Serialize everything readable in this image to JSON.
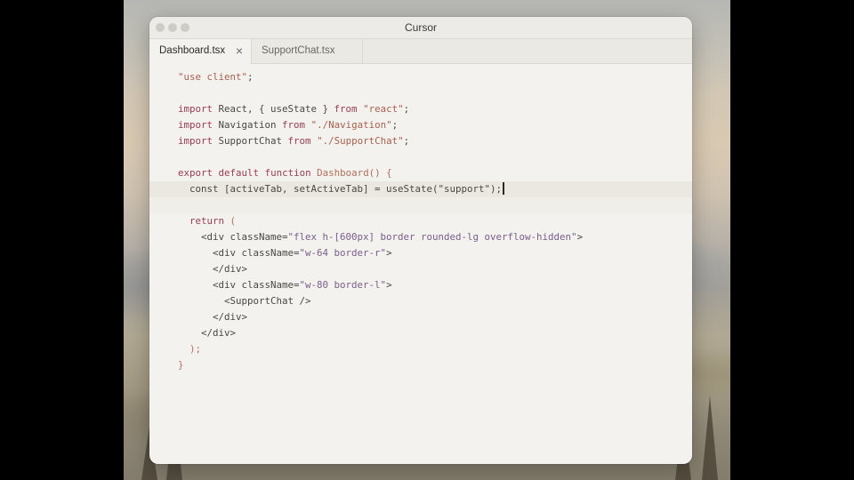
{
  "window": {
    "title": "Cursor"
  },
  "tabs": [
    {
      "label": "Dashboard.tsx",
      "active": true,
      "close_icon": "close-icon"
    },
    {
      "label": "SupportChat.tsx",
      "active": false
    }
  ],
  "editor": {
    "lines": [
      [
        {
          "t": "\"use client\"",
          "c": "str"
        },
        {
          "t": ";",
          "c": "plain"
        }
      ],
      [],
      [
        {
          "t": "import",
          "c": "kw"
        },
        {
          "t": " React, { useState } ",
          "c": "plain"
        },
        {
          "t": "from",
          "c": "kw"
        },
        {
          "t": " ",
          "c": "plain"
        },
        {
          "t": "\"react\"",
          "c": "str"
        },
        {
          "t": ";",
          "c": "plain"
        }
      ],
      [
        {
          "t": "import",
          "c": "kw"
        },
        {
          "t": " Navigation ",
          "c": "plain"
        },
        {
          "t": "from",
          "c": "kw"
        },
        {
          "t": " ",
          "c": "plain"
        },
        {
          "t": "\"./Navigation\"",
          "c": "str"
        },
        {
          "t": ";",
          "c": "plain"
        }
      ],
      [
        {
          "t": "import",
          "c": "kw"
        },
        {
          "t": " SupportChat ",
          "c": "plain"
        },
        {
          "t": "from",
          "c": "kw"
        },
        {
          "t": " ",
          "c": "plain"
        },
        {
          "t": "\"./SupportChat\"",
          "c": "str"
        },
        {
          "t": ";",
          "c": "plain"
        }
      ],
      [],
      [
        {
          "t": "export",
          "c": "kw"
        },
        {
          "t": " ",
          "c": "plain"
        },
        {
          "t": "default",
          "c": "kw"
        },
        {
          "t": " ",
          "c": "plain"
        },
        {
          "t": "function",
          "c": "kw"
        },
        {
          "t": " ",
          "c": "plain"
        },
        {
          "t": "Dashboard",
          "c": "fn"
        },
        {
          "t": "() {",
          "c": "punc"
        }
      ],
      [
        {
          "t": "  const [activeTab, setActiveTab] = useState(\"support\");",
          "c": "plain"
        }
      ],
      [],
      [
        {
          "t": "  ",
          "c": "plain"
        },
        {
          "t": "return",
          "c": "kw"
        },
        {
          "t": " (",
          "c": "punc"
        }
      ],
      [
        {
          "t": "    <div ",
          "c": "tag"
        },
        {
          "t": "className",
          "c": "attr"
        },
        {
          "t": "=",
          "c": "plain"
        },
        {
          "t": "\"flex h-[600px] border rounded-lg overflow-hidden\"",
          "c": "attrval"
        },
        {
          "t": ">",
          "c": "tag"
        }
      ],
      [
        {
          "t": "      <div ",
          "c": "tag"
        },
        {
          "t": "className",
          "c": "attr"
        },
        {
          "t": "=",
          "c": "plain"
        },
        {
          "t": "\"w-64 border-r\"",
          "c": "attrval"
        },
        {
          "t": ">",
          "c": "tag"
        }
      ],
      [
        {
          "t": "      </div>",
          "c": "tag"
        }
      ],
      [
        {
          "t": "      <div ",
          "c": "tag"
        },
        {
          "t": "className",
          "c": "attr"
        },
        {
          "t": "=",
          "c": "plain"
        },
        {
          "t": "\"w-80 border-l\"",
          "c": "attrval"
        },
        {
          "t": ">",
          "c": "tag"
        }
      ],
      [
        {
          "t": "        <SupportChat />",
          "c": "tag"
        }
      ],
      [
        {
          "t": "      </div>",
          "c": "tag"
        }
      ],
      [
        {
          "t": "    </div>",
          "c": "tag"
        }
      ],
      [
        {
          "t": "  );",
          "c": "punc"
        }
      ],
      [
        {
          "t": "}",
          "c": "punc"
        }
      ]
    ],
    "highlighted_line": 7,
    "ghost_line": 8,
    "cursor_line": 7
  }
}
